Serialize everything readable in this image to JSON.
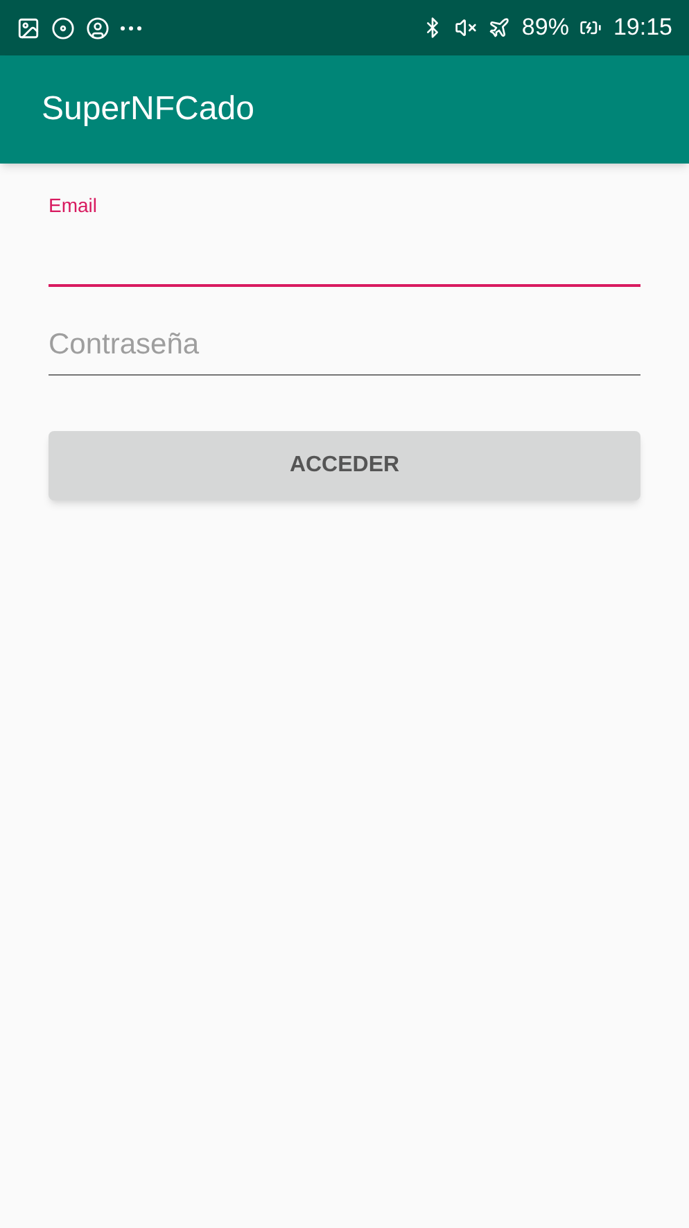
{
  "status_bar": {
    "battery": "89%",
    "time": "19:15"
  },
  "app_bar": {
    "title": "SuperNFCado"
  },
  "fields": [
    {
      "label": "Email",
      "focused": true
    },
    {
      "placeholder": "Contraseña",
      "focused": false
    }
  ],
  "buttons": [
    {
      "label": "ACCEDER"
    }
  ]
}
